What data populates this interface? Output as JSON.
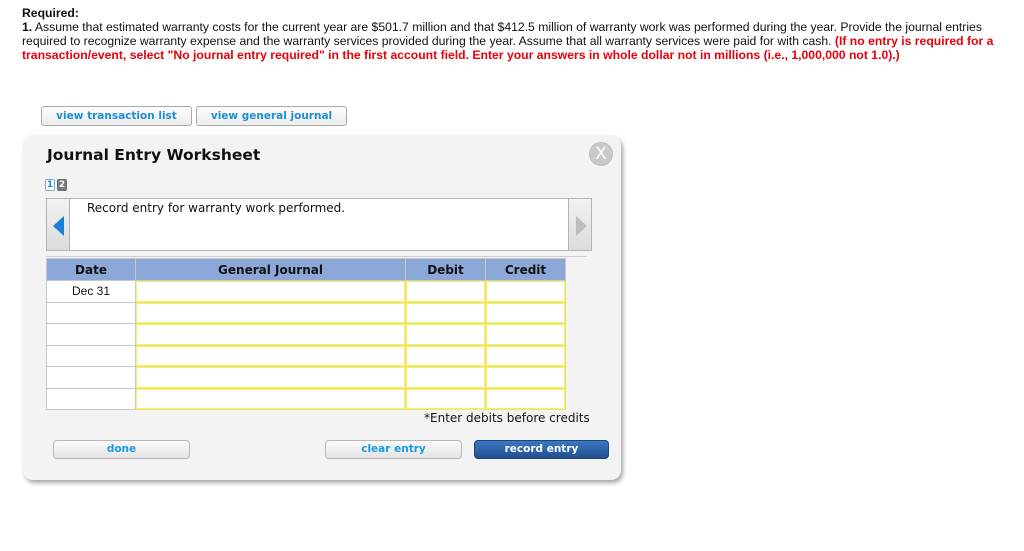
{
  "instructions": {
    "required_label": "Required:",
    "item_number": "1.",
    "body_text": " Assume that estimated warranty costs for the current year are $501.7 million and that $412.5 million of warranty work was performed during the year. Provide the journal entries required to recognize warranty expense and the warranty services provided during the year. Assume that all warranty services were paid for with cash. ",
    "red_note": "(If no entry is required for a transaction/event, select \"No journal entry required\" in the first account field. Enter your answers in whole dollar not in millions (i.e., 1,000,000 not 1.0).)"
  },
  "top_buttons": {
    "view_transaction_list": "view transaction list",
    "view_general_journal": "view general journal"
  },
  "worksheet": {
    "title": "Journal Entry Worksheet",
    "close_icon": "X",
    "pages": [
      "1",
      "2"
    ],
    "active_page": "1",
    "instruction": "Record entry for warranty work performed.",
    "columns": {
      "date": "Date",
      "account": "General Journal",
      "debit": "Debit",
      "credit": "Credit"
    },
    "rows": [
      {
        "date": "Dec 31",
        "account": "",
        "debit": "",
        "credit": ""
      },
      {
        "date": "",
        "account": "",
        "debit": "",
        "credit": ""
      },
      {
        "date": "",
        "account": "",
        "debit": "",
        "credit": ""
      },
      {
        "date": "",
        "account": "",
        "debit": "",
        "credit": ""
      },
      {
        "date": "",
        "account": "",
        "debit": "",
        "credit": ""
      },
      {
        "date": "",
        "account": "",
        "debit": "",
        "credit": ""
      }
    ],
    "hint": "*Enter debits before credits",
    "buttons": {
      "done": "done",
      "clear_entry": "clear entry",
      "record_entry": "record entry"
    }
  },
  "colors": {
    "header_blue": "#8ca8d8",
    "accent_blue": "#1a8fd8",
    "warning_red": "#e8000b",
    "input_yellow": "#f7f060"
  }
}
